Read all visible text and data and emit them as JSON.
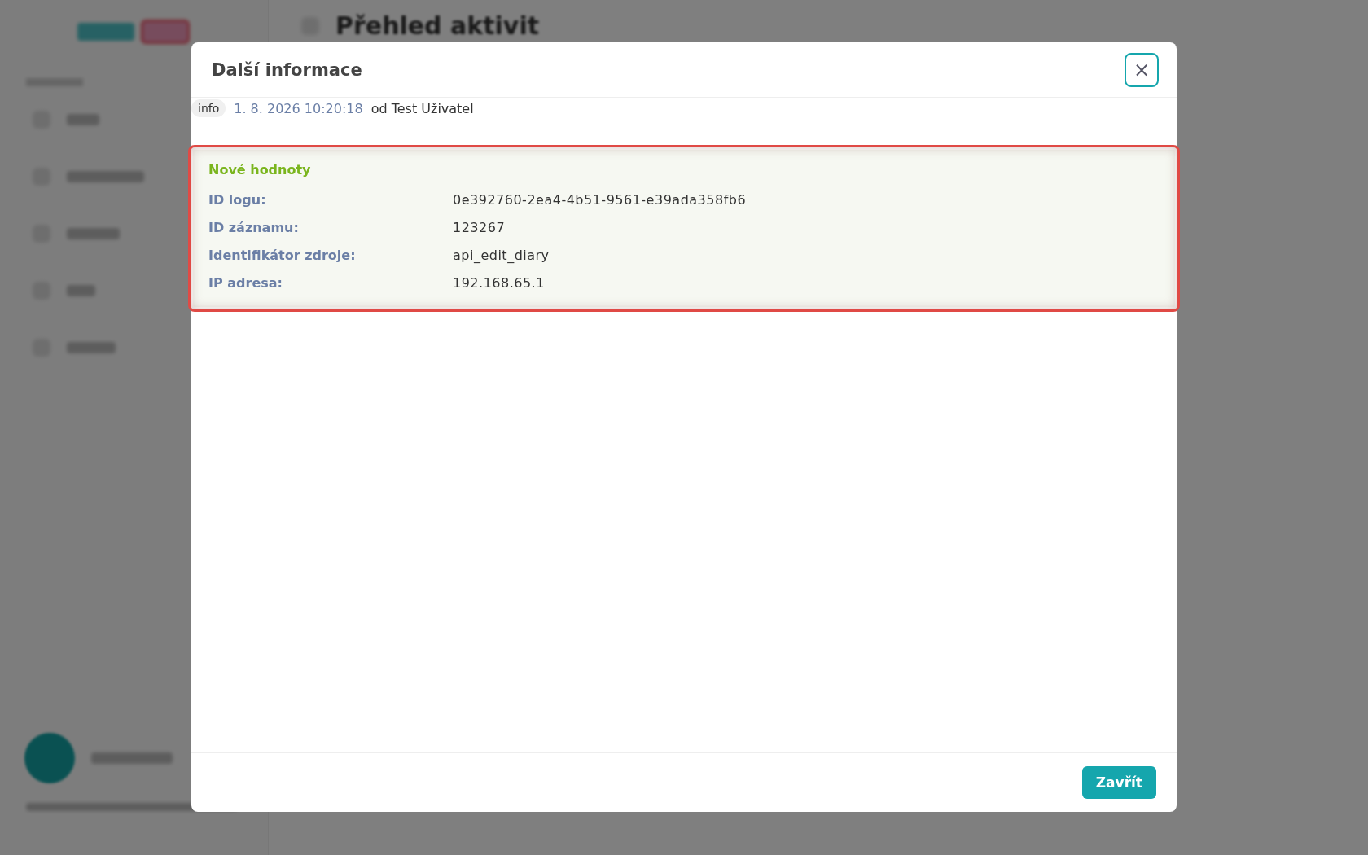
{
  "page": {
    "title": "Přehled aktivit"
  },
  "modal": {
    "title": "Další informace",
    "close_icon": "×",
    "meta": {
      "level": "info",
      "timestamp": "1. 8. 2026 10:20:18",
      "author": "od Test Uživatel"
    },
    "section": {
      "title": "Nové hodnoty",
      "highlighted": true,
      "rows": [
        {
          "label": "ID logu:",
          "value": "0e392760-2ea4-4b51-9561-e39ada358fb6"
        },
        {
          "label": "ID záznamu:",
          "value": "123267"
        },
        {
          "label": "Identifikátor zdroje:",
          "value": "api_edit_diary"
        },
        {
          "label": "IP adresa:",
          "value": "192.168.65.1"
        }
      ]
    },
    "buttons": [
      {
        "label": "Zavřít"
      }
    ]
  }
}
